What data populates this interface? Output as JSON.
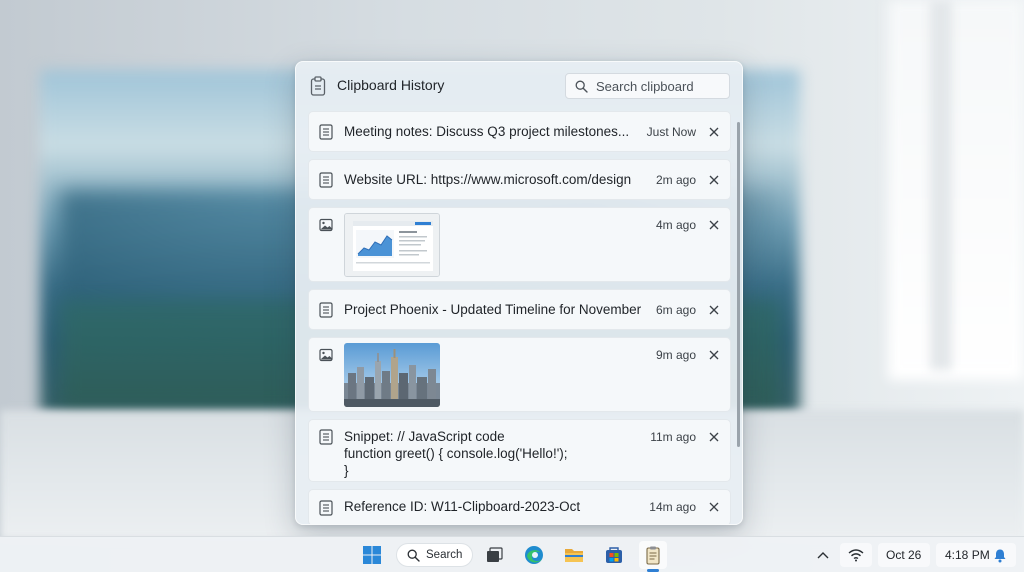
{
  "panel": {
    "title": "Clipboard History",
    "search_placeholder": "Search clipboard",
    "items": [
      {
        "kind": "text",
        "text": "Meeting notes: Discuss Q3 project milestones...",
        "time": "Just Now"
      },
      {
        "kind": "text",
        "text": "Website URL: https://www.microsoft.com/design",
        "time": "2m ago"
      },
      {
        "kind": "image",
        "thumbnail": "document-screenshot",
        "time": "4m ago"
      },
      {
        "kind": "text",
        "text": "Project Phoenix - Updated Timeline for November",
        "time": "6m ago"
      },
      {
        "kind": "image",
        "thumbnail": "city-skyline-photo",
        "time": "9m ago"
      },
      {
        "kind": "text",
        "text": "Snippet: // JavaScript code\nfunction greet() { console.log('Hello!');\n}",
        "time": "11m ago"
      },
      {
        "kind": "text",
        "text": "Reference ID: W11-Clipboard-2023-Oct",
        "time": "14m ago"
      }
    ]
  },
  "taskbar": {
    "search_label": "Search",
    "date": "Oct 26",
    "time": "4:18 PM",
    "apps": [
      "start-icon",
      "search",
      "task-view-icon",
      "edge-icon",
      "file-explorer-icon",
      "store-icon",
      "clipboard-app-icon"
    ],
    "tray_icons": [
      "chevron-up-icon",
      "wifi-icon",
      "bell-icon"
    ]
  },
  "colors": {
    "accent": "#2f7fd3",
    "panel_bg": "#e8eef3",
    "item_bg": "#f5f8fa"
  }
}
